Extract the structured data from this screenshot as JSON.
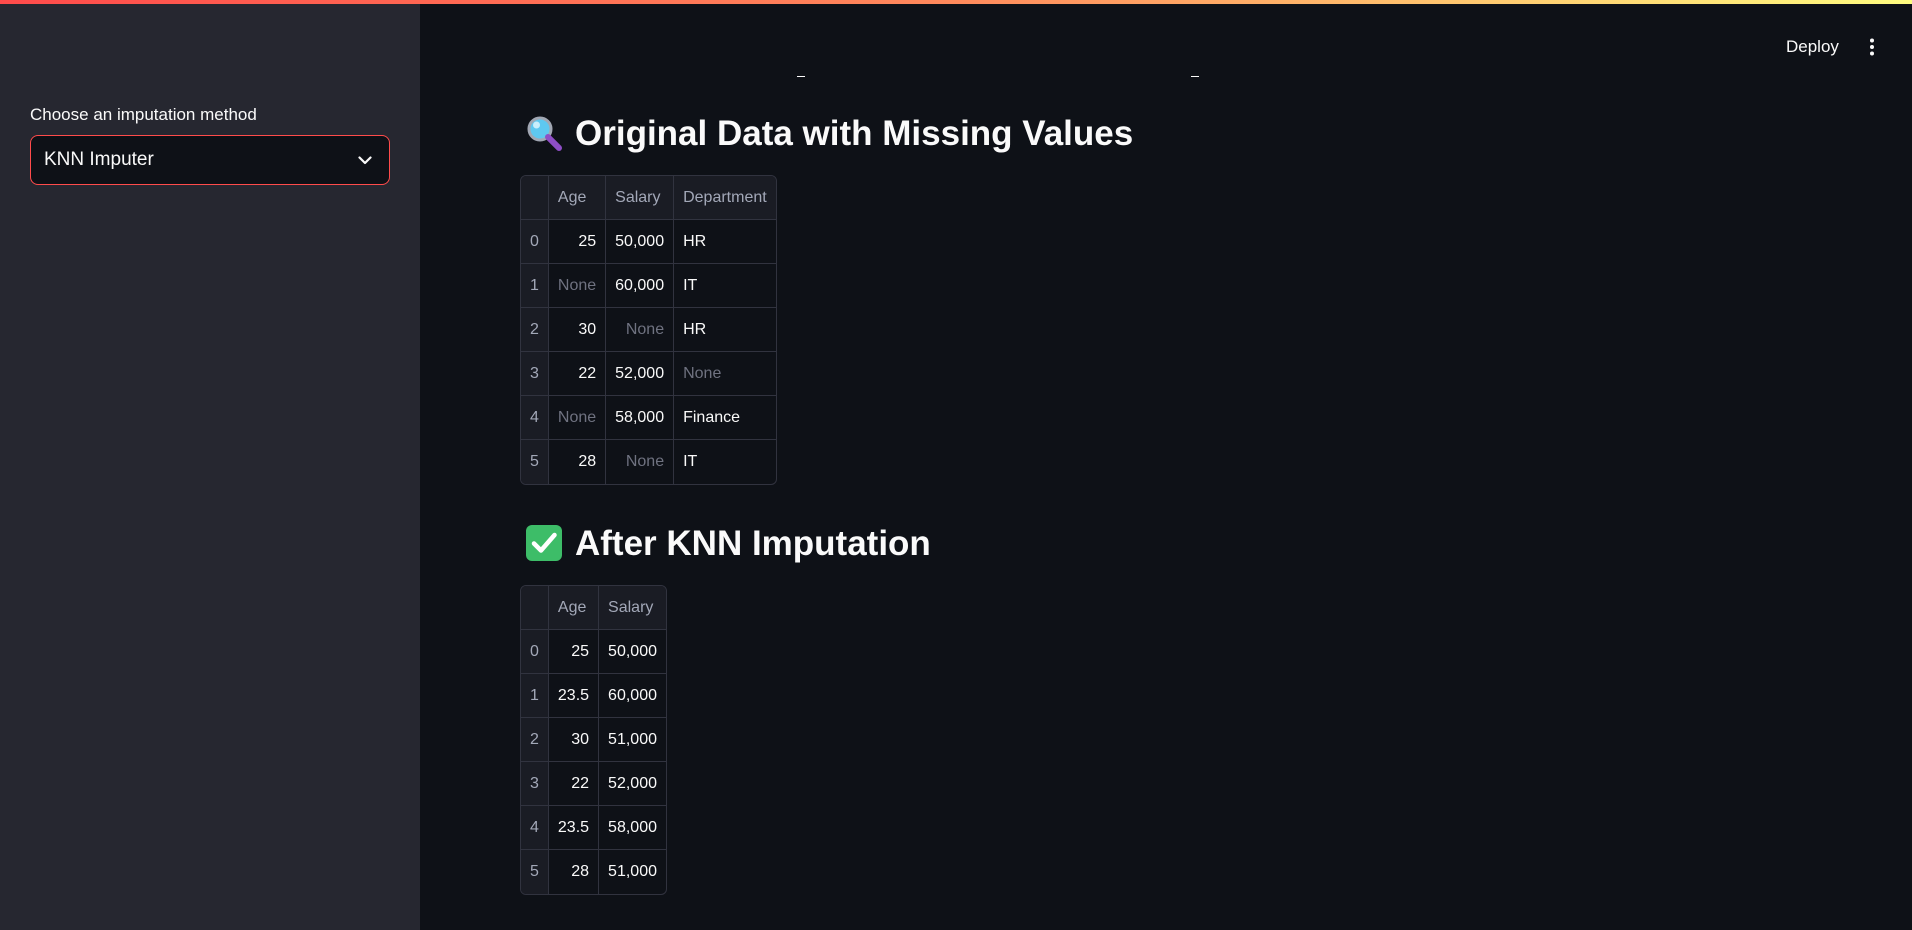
{
  "sidebar": {
    "select_label": "Choose an imputation method",
    "select_value": "KNN Imputer"
  },
  "header": {
    "deploy_label": "Deploy",
    "menu_icon": "kebab-menu-icon"
  },
  "original": {
    "heading": "Original Data with Missing Values",
    "icon": "magnifier-icon",
    "columns": [
      "",
      "Age",
      "Salary",
      "Department"
    ],
    "rows": [
      [
        "0",
        "25",
        "50,000",
        "HR"
      ],
      [
        "1",
        "None",
        "60,000",
        "IT"
      ],
      [
        "2",
        "30",
        "None",
        "HR"
      ],
      [
        "3",
        "22",
        "52,000",
        "None"
      ],
      [
        "4",
        "None",
        "58,000",
        "Finance"
      ],
      [
        "5",
        "28",
        "None",
        "IT"
      ]
    ]
  },
  "imputed": {
    "heading": "After KNN Imputation",
    "icon": "check-mark-icon",
    "columns": [
      "",
      "Age",
      "Salary"
    ],
    "rows": [
      [
        "0",
        "25",
        "50,000"
      ],
      [
        "1",
        "23.5",
        "60,000"
      ],
      [
        "2",
        "30",
        "51,000"
      ],
      [
        "3",
        "22",
        "52,000"
      ],
      [
        "4",
        "23.5",
        "58,000"
      ],
      [
        "5",
        "28",
        "51,000"
      ]
    ]
  },
  "colors": {
    "accent": "#ff4b4b",
    "background": "#0e1117",
    "sidebar": "#262730",
    "check_green": "#3dbd68"
  }
}
